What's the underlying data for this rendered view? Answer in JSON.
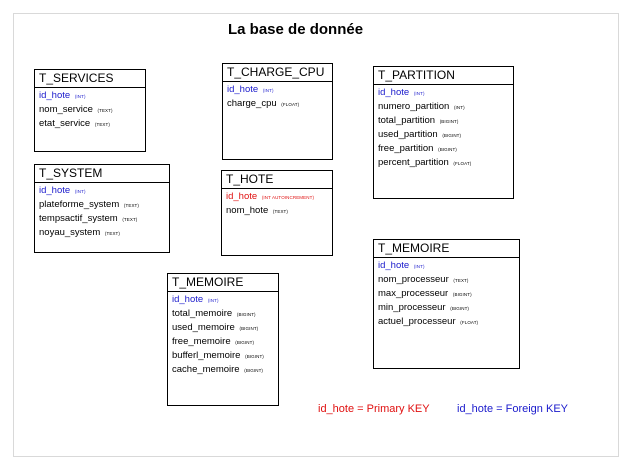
{
  "title": "La base de donnée",
  "tables": {
    "services": {
      "name": "T_SERVICES",
      "rows": [
        {
          "field": "id_hote",
          "type": "(INT)",
          "key": "fk"
        },
        {
          "field": "nom_service",
          "type": "(TEXT)",
          "key": ""
        },
        {
          "field": "etat_service",
          "type": "(TEXT)",
          "key": ""
        }
      ]
    },
    "charge_cpu": {
      "name": "T_CHARGE_CPU",
      "rows": [
        {
          "field": "id_hote",
          "type": "(INT)",
          "key": "fk"
        },
        {
          "field": "charge_cpu",
          "type": "(FLOAT)",
          "key": ""
        }
      ]
    },
    "partition": {
      "name": "T_PARTITION",
      "rows": [
        {
          "field": "id_hote",
          "type": "(INT)",
          "key": "fk"
        },
        {
          "field": "numero_partition",
          "type": "(INT)",
          "key": ""
        },
        {
          "field": "total_partition",
          "type": "(BIGINT)",
          "key": ""
        },
        {
          "field": "used_partition",
          "type": "(BIGINT)",
          "key": ""
        },
        {
          "field": "free_partition",
          "type": "(BIGINT)",
          "key": ""
        },
        {
          "field": "percent_partition",
          "type": "(FLOAT)",
          "key": ""
        }
      ]
    },
    "system": {
      "name": "T_SYSTEM",
      "rows": [
        {
          "field": "id_hote",
          "type": "(INT)",
          "key": "fk"
        },
        {
          "field": "plateforme_system",
          "type": "(TEXT)",
          "key": ""
        },
        {
          "field": "tempsactif_system",
          "type": "(TEXT)",
          "key": ""
        },
        {
          "field": "noyau_system",
          "type": "(TEXT)",
          "key": ""
        }
      ]
    },
    "hote": {
      "name": "T_HOTE",
      "rows": [
        {
          "field": "id_hote",
          "type": "(INT AUTOINCREMENT)",
          "key": "pk"
        },
        {
          "field": "nom_hote",
          "type": "(TEXT)",
          "key": ""
        }
      ]
    },
    "memoire_cpu": {
      "name": "T_MEMOIRE",
      "rows": [
        {
          "field": "id_hote",
          "type": "(INT)",
          "key": "fk"
        },
        {
          "field": "nom_processeur",
          "type": "(TEXT)",
          "key": ""
        },
        {
          "field": "max_processeur",
          "type": "(BIGINT)",
          "key": ""
        },
        {
          "field": "min_processeur",
          "type": "(BIGINT)",
          "key": ""
        },
        {
          "field": "actuel_processeur",
          "type": "(FLOAT)",
          "key": ""
        }
      ]
    },
    "memoire": {
      "name": "T_MEMOIRE",
      "rows": [
        {
          "field": "id_hote",
          "type": "(INT)",
          "key": "fk"
        },
        {
          "field": "total_memoire",
          "type": "(BIGINT)",
          "key": ""
        },
        {
          "field": "used_memoire",
          "type": "(BIGINT)",
          "key": ""
        },
        {
          "field": "free_memoire",
          "type": "(BIGINT)",
          "key": ""
        },
        {
          "field": "bufferl_memoire",
          "type": "(BIGINT)",
          "key": ""
        },
        {
          "field": "cache_memoire",
          "type": "(BIGINT)",
          "key": ""
        }
      ]
    }
  },
  "legend": {
    "primary": "id_hote = Primary KEY",
    "foreign": "id_hote = Foreign KEY"
  }
}
